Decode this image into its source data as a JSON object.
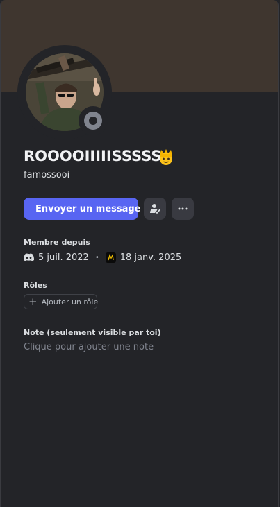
{
  "profile": {
    "display_name": "ROOOOIIIIISSSSS",
    "display_name_emoji": "crown-face-emoji",
    "username": "famossooi",
    "status": "offline"
  },
  "actions": {
    "message_label": "Envoyer un message",
    "friend_icon": "user-check-icon",
    "more_icon": "ellipsis-icon"
  },
  "member_since": {
    "title": "Membre depuis",
    "discord_date": "5 juil. 2022",
    "separator": "•",
    "server_date": "18 janv. 2025"
  },
  "roles": {
    "title": "Rôles",
    "add_label": "Ajouter un rôle"
  },
  "note": {
    "title": "Note (seulement visible par toi)",
    "placeholder": "Clique pour ajouter une note"
  },
  "colors": {
    "banner": "#3f362f",
    "background": "#232428",
    "accent": "#5865f2"
  }
}
